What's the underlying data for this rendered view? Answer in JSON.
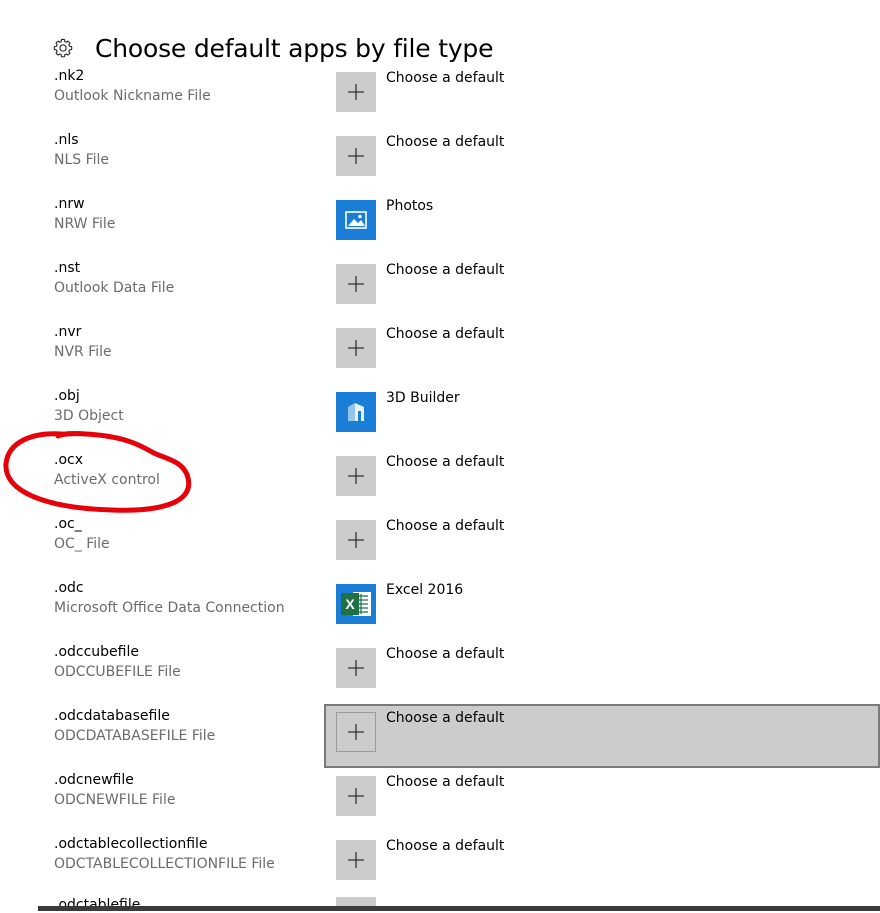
{
  "header": {
    "title": "Choose default apps by file type",
    "icon": "gear-icon"
  },
  "rows": [
    {
      "ext": ".nk2",
      "desc": "Outlook Nickname File",
      "app": "Choose a default",
      "icon": "plus-icon"
    },
    {
      "ext": ".nls",
      "desc": "NLS File",
      "app": "Choose a default",
      "icon": "plus-icon"
    },
    {
      "ext": ".nrw",
      "desc": "NRW File",
      "app": "Photos",
      "icon": "photos-icon"
    },
    {
      "ext": ".nst",
      "desc": "Outlook Data File",
      "app": "Choose a default",
      "icon": "plus-icon"
    },
    {
      "ext": ".nvr",
      "desc": "NVR File",
      "app": "Choose a default",
      "icon": "plus-icon"
    },
    {
      "ext": ".obj",
      "desc": "3D Object",
      "app": "3D Builder",
      "icon": "3d-builder-icon"
    },
    {
      "ext": ".ocx",
      "desc": "ActiveX control",
      "app": "Choose a default",
      "icon": "plus-icon"
    },
    {
      "ext": ".oc_",
      "desc": "OC_ File",
      "app": "Choose a default",
      "icon": "plus-icon"
    },
    {
      "ext": ".odc",
      "desc": "Microsoft Office Data Connection",
      "app": "Excel 2016",
      "icon": "excel-icon"
    },
    {
      "ext": ".odccubefile",
      "desc": "ODCCUBEFILE File",
      "app": "Choose a default",
      "icon": "plus-icon"
    },
    {
      "ext": ".odcdatabasefile",
      "desc": "ODCDATABASEFILE File",
      "app": "Choose a default",
      "icon": "plus-icon"
    },
    {
      "ext": ".odcnewfile",
      "desc": "ODCNEWFILE File",
      "app": "Choose a default",
      "icon": "plus-icon"
    },
    {
      "ext": ".odctablecollectionfile",
      "desc": "ODCTABLECOLLECTIONFILE File",
      "app": "Choose a default",
      "icon": "plus-icon"
    }
  ],
  "selected_row": 10,
  "annotation": {
    "color": "#e5000a",
    "highlighted_row": 6
  },
  "partial_row": {
    "ext": ".odctablefile"
  },
  "colors": {
    "tile_gray": "#cccccc",
    "tile_blue": "#1a7dd6",
    "excel_green": "#1e7145",
    "selected_bg": "#cccccc"
  }
}
